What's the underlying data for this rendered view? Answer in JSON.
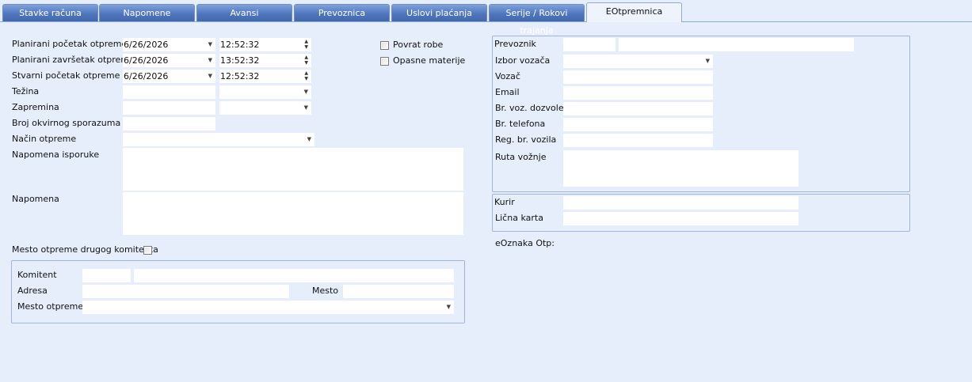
{
  "tabs": [
    "Stavke računa",
    "Napomene",
    "Avansi",
    "Prevoznica",
    "Uslovi plaćanja",
    "Serije / Rokovi trajanja",
    "EOtpremnica"
  ],
  "shipping": {
    "planned_start_label": "Planirani početak otpreme",
    "planned_start_date": "6/26/2026",
    "planned_start_time": "12:52:32",
    "planned_end_label": "Planirani završetak otpreme",
    "planned_end_date": "6/26/2026",
    "planned_end_time": "13:52:32",
    "actual_start_label": "Stvarni početak otpreme",
    "actual_start_date": "6/26/2026",
    "actual_start_time": "12:52:32",
    "weight_label": "Težina",
    "volume_label": "Zapremina",
    "framework_agreement_label": "Broj okvirnog sporazuma",
    "shipping_method_label": "Način otpreme",
    "delivery_note_label": "Napomena isporuke",
    "note_label": "Napomena",
    "other_client_location_label": "Mesto otpreme drugog komitenta"
  },
  "options": {
    "return_goods_label": "Povrat robe",
    "hazardous_label": "Opasne materije"
  },
  "client": {
    "client_label": "Komitent",
    "address_label": "Adresa",
    "place_label": "Mesto",
    "shipping_place_label": "Mesto otpreme"
  },
  "carrier": {
    "carrier_label": "Prevoznik",
    "driver_select_label": "Izbor vozača",
    "driver_label": "Vozač",
    "email_label": "Email",
    "permit_label": "Br. voz. dozvole",
    "phone_label": "Br. telefona",
    "plate_label": "Reg. br. vozila",
    "route_label": "Ruta vožnje"
  },
  "courier": {
    "courier_label": "Kurir",
    "id_card_label": "Lična karta"
  },
  "eoznaka_label": "eOznaka Otp:"
}
